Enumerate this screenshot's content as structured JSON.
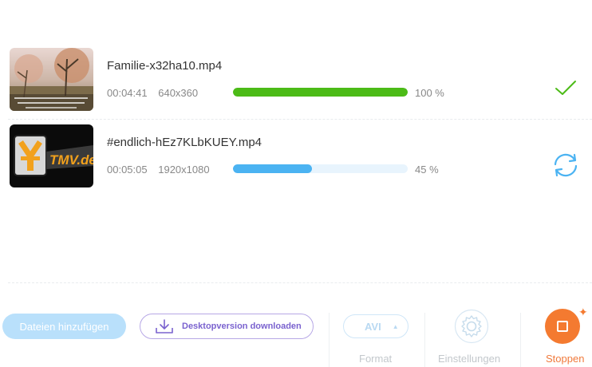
{
  "files": [
    {
      "name": "Familie-x32ha10.mp4",
      "duration": "00:04:41",
      "resolution": "640x360",
      "progress": 100,
      "progress_label": "100 %",
      "bar_color": "#4cbb17",
      "status_icon": "checkmark-icon",
      "status_color": "#4cbb17"
    },
    {
      "name": "#endlich-hEz7KLbKUEY.mp4",
      "duration": "00:05:05",
      "resolution": "1920x1080",
      "progress": 45,
      "progress_label": "45 %",
      "bar_color": "#4bb3f2",
      "status_icon": "sync-icon",
      "status_color": "#4bb3f2"
    }
  ],
  "thumb2_text": "TMV.de",
  "toolbar": {
    "add_files_label": "Dateien hinzufügen",
    "desktop_label": "Desktopversion downloaden",
    "format_value": "AVI",
    "format_label": "Format",
    "settings_label": "Einstellungen",
    "stop_label": "Stoppen"
  },
  "colors": {
    "accent_orange": "#f47a30",
    "accent_blue": "#4bb3f2",
    "accent_green": "#4cbb17",
    "accent_purple": "#7a62cf"
  }
}
